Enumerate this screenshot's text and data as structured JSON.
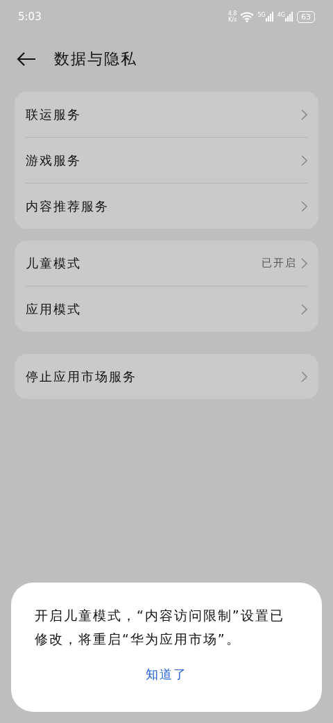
{
  "status_bar": {
    "time": "5:03",
    "net_speed": "4.8",
    "net_speed_unit": "K/s",
    "signal_1": "5G",
    "signal_2": "4G",
    "battery": "63"
  },
  "header": {
    "title": "数据与隐私"
  },
  "groups": [
    {
      "items": [
        {
          "label": "联运服务"
        },
        {
          "label": "游戏服务"
        },
        {
          "label": "内容推荐服务"
        }
      ]
    },
    {
      "items": [
        {
          "label": "儿童模式",
          "value": "已开启"
        },
        {
          "label": "应用模式"
        }
      ]
    },
    {
      "items": [
        {
          "label": "停止应用市场服务"
        }
      ]
    }
  ],
  "dialog": {
    "message": "开启儿童模式，“内容访问限制”设置已修改，将重启“华为应用市场”。",
    "button": "知道了"
  }
}
